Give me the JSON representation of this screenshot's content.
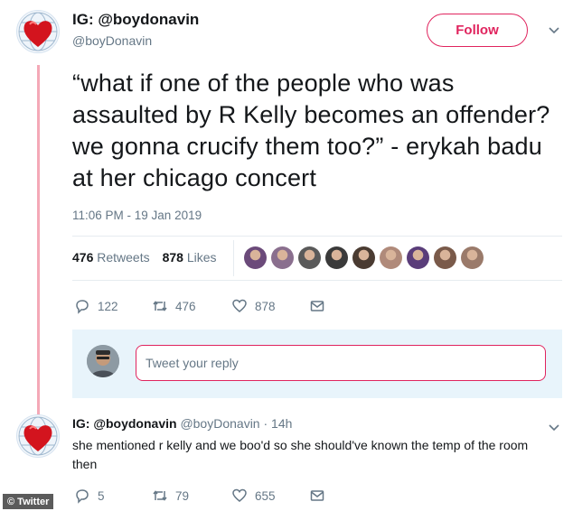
{
  "tweet": {
    "display_name": "IG: @boydonavin",
    "handle": "@boyDonavin",
    "follow_label": "Follow",
    "text": "“what if one of the people who was assaulted by R Kelly becomes an offender? we gonna crucify them too?” - erykah badu at her chicago concert",
    "timestamp": "11:06 PM - 19 Jan 2019",
    "retweets_count": "476",
    "retweets_label": "Retweets",
    "likes_count": "878",
    "likes_label": "Likes",
    "actions": {
      "reply": "122",
      "retweet": "476",
      "like": "878"
    },
    "liker_colors": [
      "#6b4a7a",
      "#8a6f8e",
      "#5a5a5a",
      "#3a3a3a",
      "#4a3b32",
      "#b08a7a",
      "#5a3d7a",
      "#7a5a4a",
      "#9a7a6a"
    ]
  },
  "reply_box": {
    "placeholder": "Tweet your reply"
  },
  "reply": {
    "display_name": "IG: @boydonavin",
    "handle": "@boyDonavin",
    "separator": "·",
    "time": "14h",
    "text": "she mentioned r kelly and we boo'd so she should've known the temp of the room then",
    "actions": {
      "reply": "5",
      "retweet": "79",
      "like": "655"
    }
  },
  "watermark": "© Twitter",
  "colors": {
    "accent": "#e0245e",
    "muted": "#657786",
    "thread_line": "#f4a9b7"
  }
}
